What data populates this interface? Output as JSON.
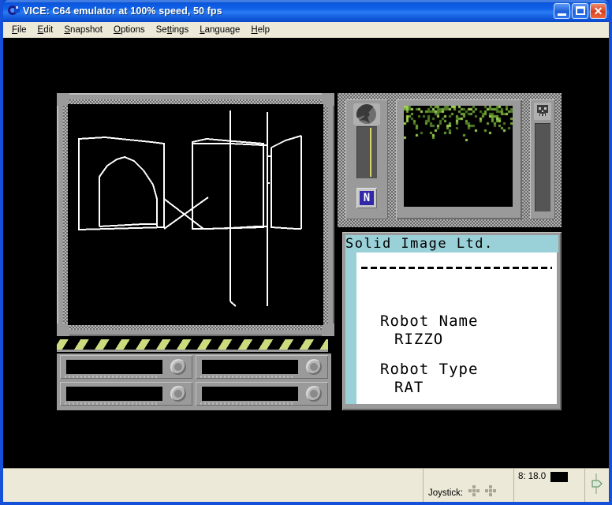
{
  "window": {
    "title": "VICE: C64 emulator at 100% speed, 50 fps",
    "app_icon": "vice-icon",
    "controls": {
      "minimize_label": "",
      "maximize_label": "",
      "close_label": "✕"
    }
  },
  "menu": {
    "items": [
      {
        "label": "File",
        "accel": "F"
      },
      {
        "label": "Edit",
        "accel": "E"
      },
      {
        "label": "Snapshot",
        "accel": "S"
      },
      {
        "label": "Options",
        "accel": "O"
      },
      {
        "label": "Settings",
        "accel": "tt"
      },
      {
        "label": "Language",
        "accel": "L"
      },
      {
        "label": "Help",
        "accel": "H"
      }
    ]
  },
  "emulator": {
    "background": "#000000",
    "screen": {
      "left_viewport": {
        "name": "wireframe-viewport",
        "background": "#000000",
        "line_color": "#ffffff"
      },
      "hazard_bar": {
        "stripe_color": "#cbdb7d",
        "background": "#000000"
      },
      "slots": [
        {
          "label": ""
        },
        {
          "label": ""
        },
        {
          "label": ""
        },
        {
          "label": ""
        }
      ],
      "instruments": {
        "radiation_gauge": {
          "icon": "radiation-icon",
          "needle_color": "#d6d66a",
          "value": ""
        },
        "n_button": {
          "label": "N",
          "key_color": "#3028a8"
        },
        "radar": {
          "name": "radar-display",
          "dot_color": "#7ab33c",
          "background": "#000000"
        },
        "toxicity_gauge": {
          "icon": "skull-icon",
          "value": ""
        }
      },
      "info_panel": {
        "title": "Solid Image Ltd.",
        "title_bg": "#9ad1d8",
        "rows": [
          {
            "label": "Robot Name",
            "value": "RIZZO"
          },
          {
            "label": "Robot Type",
            "value": "RAT"
          }
        ]
      }
    }
  },
  "status_bar": {
    "joystick_label": "Joystick:",
    "drive_status": "8: 18.0",
    "drive_led_color": "#000000",
    "tape_icon": "tape-counter-icon"
  }
}
